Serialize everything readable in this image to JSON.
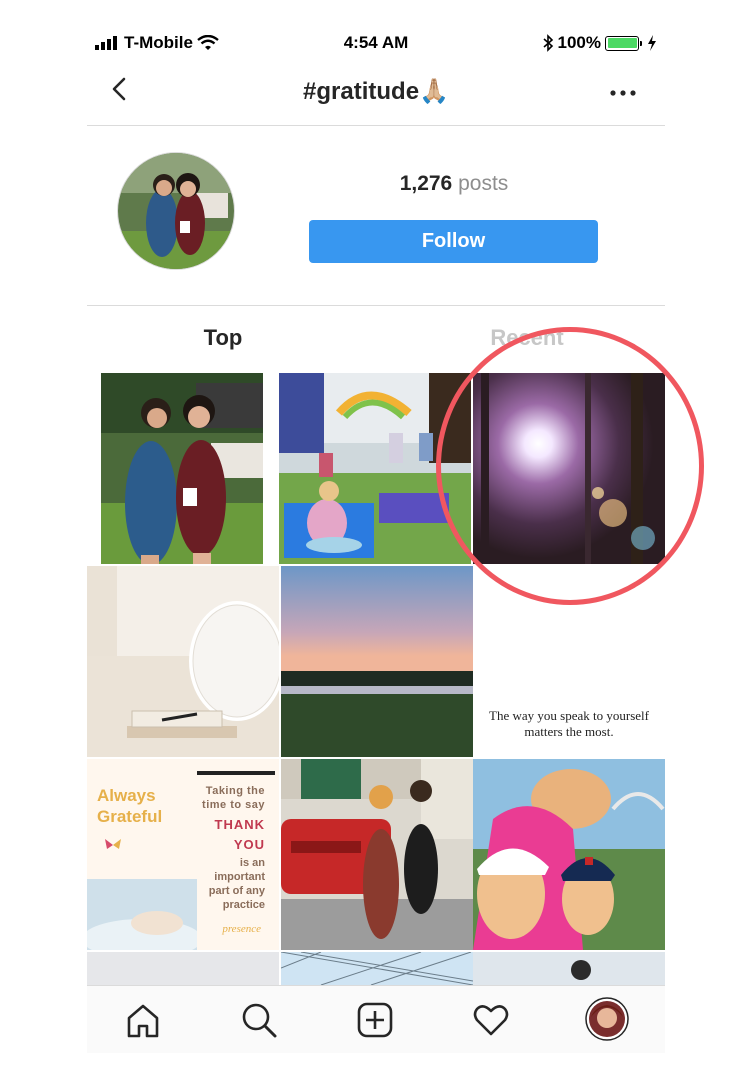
{
  "status_bar": {
    "carrier": "T-Mobile",
    "time": "4:54 AM",
    "battery_percent": "100%",
    "battery_level": 1.0
  },
  "header": {
    "title": "#gratitude🙏🏼",
    "icons": [
      "chevron-left-icon",
      "more-icon"
    ]
  },
  "profile": {
    "post_count": "1,276",
    "post_label": "posts",
    "follow_label": "Follow"
  },
  "tabs": [
    {
      "label": "Top",
      "active": true
    },
    {
      "label": "Recent",
      "active": false
    }
  ],
  "grid": {
    "quote_text": "The way you speak to yourself matters the most.",
    "grateful_card": {
      "heading": "Always Grateful",
      "body": [
        "Taking the",
        "time to say"
      ],
      "emphasis": [
        "THANK",
        "YOU"
      ],
      "tail": [
        "is an",
        "important",
        "part of any",
        "practice"
      ],
      "logo": "presence"
    }
  },
  "bottom_nav": {
    "icons": [
      "home-icon",
      "search-icon",
      "add-post-icon",
      "heart-icon",
      "profile-avatar"
    ]
  },
  "annotation": {
    "highlight_color": "#f0575f"
  }
}
